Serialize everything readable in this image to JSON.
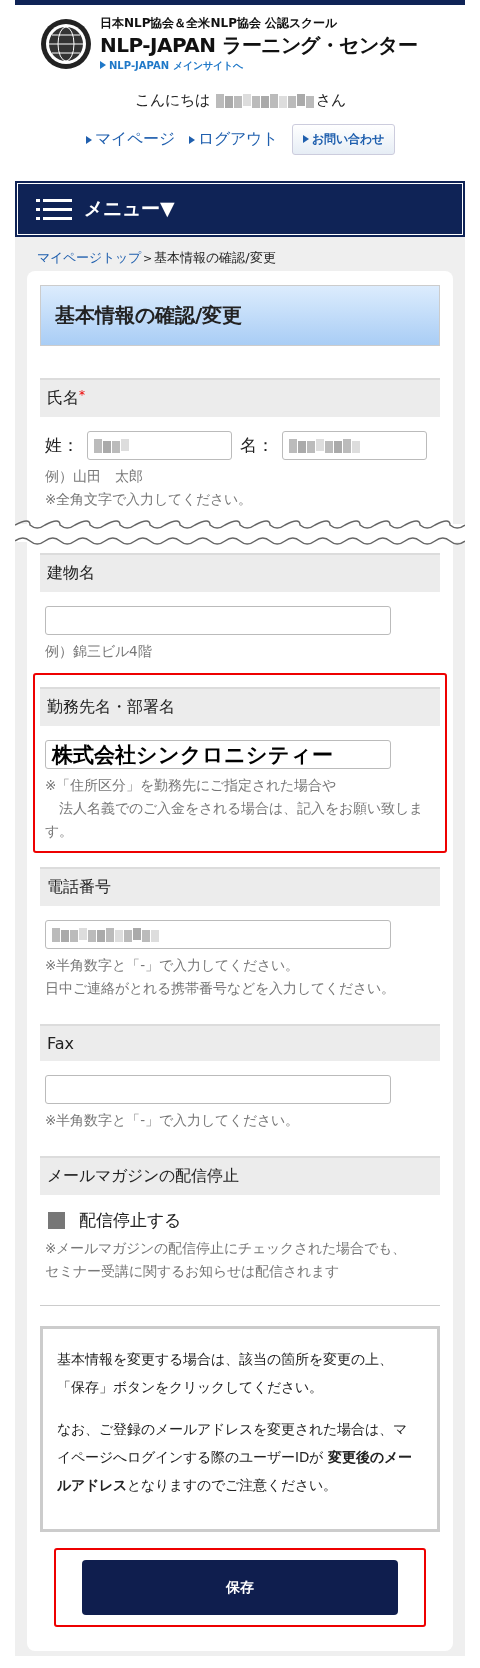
{
  "header": {
    "tagline": "日本NLP協会＆全米NLP協会 公認スクール",
    "title": "NLP-JAPAN ラーニング・センター",
    "main_site_link": "NLP-JAPAN メインサイトへ",
    "greeting_prefix": "こんにちは",
    "greeting_suffix": "さん",
    "name_blurred": true,
    "nav_links": [
      "マイページ",
      "ログアウト"
    ],
    "contact_button": "お問い合わせ"
  },
  "menu": {
    "label": "メニュー▼"
  },
  "breadcrumb": {
    "link": "マイページトップ",
    "separator": ">",
    "current": "基本情報の確認/変更"
  },
  "page_title": "基本情報の確認/変更",
  "sections": [
    {
      "kind": "name",
      "label": "氏名",
      "required_mark": "*",
      "fields": [
        {
          "label": "姓：",
          "blurred": true
        },
        {
          "label": "名：",
          "blurred": true
        }
      ],
      "notes": [
        "例）山田　太郎",
        "※全角文字で入力してください。"
      ]
    },
    {
      "kind": "text",
      "label": "建物名",
      "break_before": true,
      "blurred": false,
      "notes": [
        "例）錦三ビル4階"
      ]
    },
    {
      "kind": "text",
      "label": "勤務先名・部署名",
      "highlighted": true,
      "blurred": false,
      "value": "株式会社シンクロニシティー",
      "notes": [
        "※「住所区分」を勤務先にご指定された場合や",
        "　法人名義でのご入金をされる場合は、記入をお願い致します。"
      ]
    },
    {
      "kind": "text",
      "label": "電話番号",
      "blurred": true,
      "notes": [
        "※半角数字と「-」で入力してください。",
        "日中ご連絡がとれる携帯番号などを入力してください。"
      ]
    },
    {
      "kind": "text",
      "label": "Fax",
      "blurred": false,
      "notes": [
        "※半角数字と「-」で入力してください。"
      ]
    },
    {
      "kind": "checkbox",
      "label": "メールマガジンの配信停止",
      "option": "配信停止する",
      "checked": false,
      "notes": [
        "※メールマガジンの配信停止にチェックされた場合でも、",
        "セミナー受講に関するお知らせは配信されます"
      ]
    }
  ],
  "info": [
    "基本情報を変更する場合は、該当の箇所を変更の上、「保存」ボタンをクリックしてください。",
    "なお、ご登録のメールアドレスを変更された場合は、マイページへログインする際のユーザーIDが **変更後のメールアドレス**となりますのでご注意ください。"
  ],
  "save_button": {
    "label": "保存",
    "highlighted": true
  }
}
